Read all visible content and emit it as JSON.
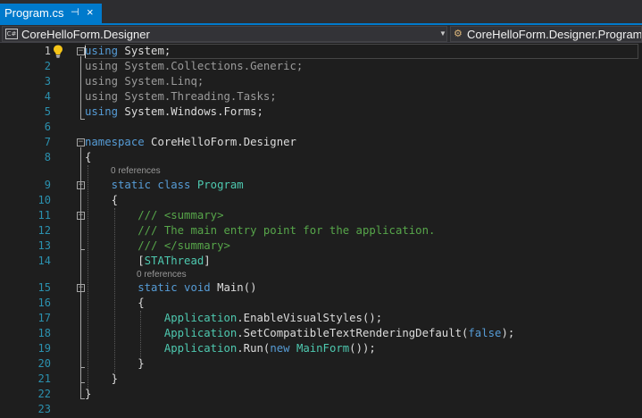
{
  "tab": {
    "title": "Program.cs",
    "pin_glyph": "⊣",
    "close_glyph": "×"
  },
  "navbar": {
    "file_icon_text": "C#",
    "project": "CoreHelloForm.Designer",
    "type": "CoreHelloForm.Designer.Program"
  },
  "gutter": [
    "1",
    "2",
    "3",
    "4",
    "5",
    "6",
    "7",
    "8",
    "9",
    "10",
    "11",
    "12",
    "13",
    "14",
    "15",
    "16",
    "17",
    "18",
    "19",
    "20",
    "21",
    "22",
    "23"
  ],
  "codelens": {
    "program_refs": "0 references",
    "main_refs": "0 references"
  },
  "code": {
    "l1_kw": "using",
    "l1_rest": " System;",
    "l2_kw": "using",
    "l2_rest": " System.Collections.Generic;",
    "l3_kw": "using",
    "l3_rest": " System.Linq;",
    "l4_kw": "using",
    "l4_rest": " System.Threading.Tasks;",
    "l5_kw": "using",
    "l5_rest": " System.Windows.Forms;",
    "l7_kw": "namespace",
    "l7_rest": " CoreHelloForm.Designer",
    "l8": "{",
    "l9_kw": "    static class",
    "l9_type": " Program",
    "l10": "    {",
    "l11": "        /// <summary>",
    "l12": "        /// The main entry point for the application.",
    "l13": "        /// </summary>",
    "l14_a": "        [",
    "l14_type": "STAThread",
    "l14_b": "]",
    "l15_kw": "        static void",
    "l15_rest": " Main()",
    "l16": "        {",
    "l17_indent": "            ",
    "l17_type": "Application",
    "l17_rest": ".EnableVisualStyles();",
    "l18_indent": "            ",
    "l18_type": "Application",
    "l18_rest": ".SetCompatibleTextRenderingDefault(",
    "l18_kw": "false",
    "l18_end": ");",
    "l19_indent": "            ",
    "l19_type": "Application",
    "l19_rest": ".Run(",
    "l19_kw": "new",
    "l19_sp": " ",
    "l19_type2": "MainForm",
    "l19_end": "());",
    "l20": "        }",
    "l21": "    }",
    "l22": "}"
  },
  "colors": {
    "accent": "#007acc",
    "keyword": "#569cd6",
    "type": "#4ec9b0",
    "comment": "#57a64a",
    "line_number": "#2b91af",
    "background": "#1e1e1e"
  },
  "icons": [
    "pin-icon",
    "close-icon",
    "csharp-file-icon",
    "dropdown-arrow-icon",
    "class-icon",
    "lightbulb-icon",
    "fold-icon"
  ]
}
